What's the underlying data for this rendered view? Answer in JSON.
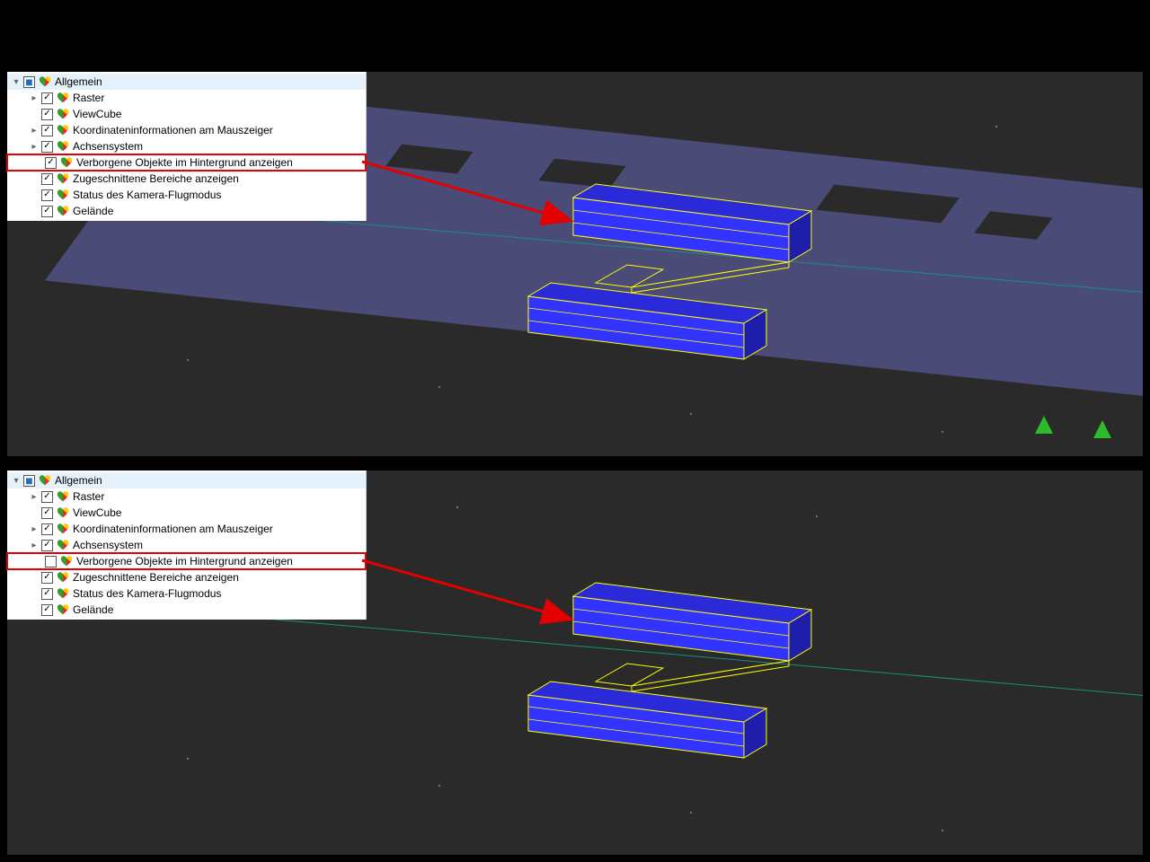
{
  "trees": {
    "top": {
      "root": {
        "label": "Allgemein",
        "check": "mixed",
        "expanded": true,
        "selected": true
      },
      "items": [
        {
          "label": "Raster",
          "check": "on",
          "expander": "closed",
          "indent": 1
        },
        {
          "label": "ViewCube",
          "check": "on",
          "expander": "none",
          "indent": 1
        },
        {
          "label": "Koordinateninformationen am Mauszeiger",
          "check": "on",
          "expander": "closed",
          "indent": 1
        },
        {
          "label": "Achsensystem",
          "check": "on",
          "expander": "closed",
          "indent": 1
        },
        {
          "label": "Verborgene Objekte im Hintergrund anzeigen",
          "check": "on",
          "expander": "none",
          "indent": 1,
          "highlighted": true
        },
        {
          "label": "Zugeschnittene Bereiche anzeigen",
          "check": "on",
          "expander": "none",
          "indent": 1
        },
        {
          "label": "Status des Kamera-Flugmodus",
          "check": "on",
          "expander": "none",
          "indent": 1
        },
        {
          "label": "Gelände",
          "check": "on",
          "expander": "none",
          "indent": 1
        }
      ]
    },
    "bottom": {
      "root": {
        "label": "Allgemein",
        "check": "mixed",
        "expanded": true,
        "selected": true
      },
      "items": [
        {
          "label": "Raster",
          "check": "on",
          "expander": "closed",
          "indent": 1
        },
        {
          "label": "ViewCube",
          "check": "on",
          "expander": "none",
          "indent": 1
        },
        {
          "label": "Koordinateninformationen am Mauszeiger",
          "check": "on",
          "expander": "closed",
          "indent": 1
        },
        {
          "label": "Achsensystem",
          "check": "on",
          "expander": "closed",
          "indent": 1
        },
        {
          "label": "Verborgene Objekte im Hintergrund anzeigen",
          "check": "off",
          "expander": "none",
          "indent": 1,
          "highlighted": true
        },
        {
          "label": "Zugeschnittene Bereiche anzeigen",
          "check": "on",
          "expander": "none",
          "indent": 1
        },
        {
          "label": "Status des Kamera-Flugmodus",
          "check": "on",
          "expander": "none",
          "indent": 1
        },
        {
          "label": "Gelände",
          "check": "on",
          "expander": "none",
          "indent": 1
        }
      ]
    }
  },
  "colors": {
    "arrow": "#e30000",
    "beam_fill": "#3333ff",
    "beam_edge": "#ffff00",
    "bridge": "#4b4b78",
    "axis": "#1a8f7d",
    "viewport_bg": "#2a2a2a"
  }
}
